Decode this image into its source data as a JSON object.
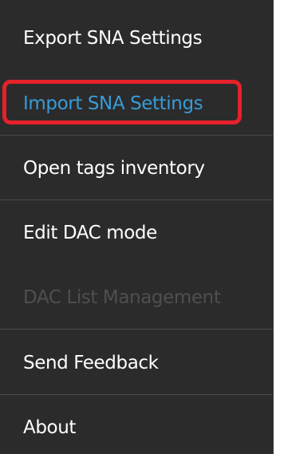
{
  "menu": {
    "items": [
      {
        "label": "Export SNA Settings",
        "state": "normal"
      },
      {
        "label": "Import SNA Settings",
        "state": "highlighted"
      },
      {
        "label": "Open tags inventory",
        "state": "normal"
      },
      {
        "label": "Edit DAC mode",
        "state": "normal"
      },
      {
        "label": "DAC List Management",
        "state": "disabled"
      },
      {
        "label": "Send Feedback",
        "state": "normal"
      },
      {
        "label": "About",
        "state": "normal"
      }
    ]
  },
  "colors": {
    "menu_background": "#2b2b2b",
    "text_normal": "#ffffff",
    "text_active": "#3a9bd6",
    "text_disabled": "#4f4f4f",
    "separator": "#4a4a4a",
    "highlight_border": "#e6212a"
  }
}
